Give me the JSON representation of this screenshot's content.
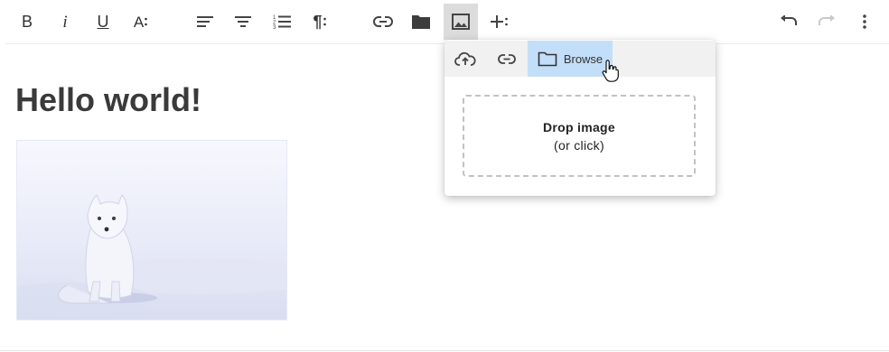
{
  "toolbar": {
    "buttons": [
      {
        "name": "bold",
        "icon": "bold-icon"
      },
      {
        "name": "italic",
        "icon": "italic-icon"
      },
      {
        "name": "underline",
        "icon": "underline-icon"
      },
      {
        "name": "font-size",
        "icon": "font-size-icon"
      },
      {
        "name": "align",
        "icon": "align-left-icon"
      },
      {
        "name": "justify",
        "icon": "align-center-icon"
      },
      {
        "name": "ordered-list",
        "icon": "ordered-list-icon"
      },
      {
        "name": "paragraph",
        "icon": "paragraph-icon"
      },
      {
        "name": "link",
        "icon": "link-icon"
      },
      {
        "name": "file",
        "icon": "folder-icon"
      },
      {
        "name": "image",
        "icon": "image-icon",
        "active": true
      },
      {
        "name": "insert",
        "icon": "plus-icon"
      },
      {
        "name": "undo",
        "icon": "undo-icon"
      },
      {
        "name": "redo",
        "icon": "redo-icon",
        "disabled": true
      },
      {
        "name": "more",
        "icon": "more-vertical-icon"
      }
    ],
    "labels": {
      "bold": "B",
      "italic": "i",
      "underline": "U",
      "font_size": "A"
    }
  },
  "editor": {
    "heading": "Hello world!",
    "image_icon": "arctic-fox-photo"
  },
  "image_popup": {
    "tabs": [
      {
        "icon": "cloud-upload-icon"
      },
      {
        "icon": "link-icon"
      },
      {
        "icon": "folder-icon",
        "label": "Browse",
        "active": true
      }
    ],
    "dropzone": {
      "title": "Drop image",
      "subtitle": "(or click)"
    }
  },
  "colors": {
    "active_tab": "#c3def9",
    "active_toolbar": "#dcdcdc",
    "icon": "#4a4a4a"
  }
}
